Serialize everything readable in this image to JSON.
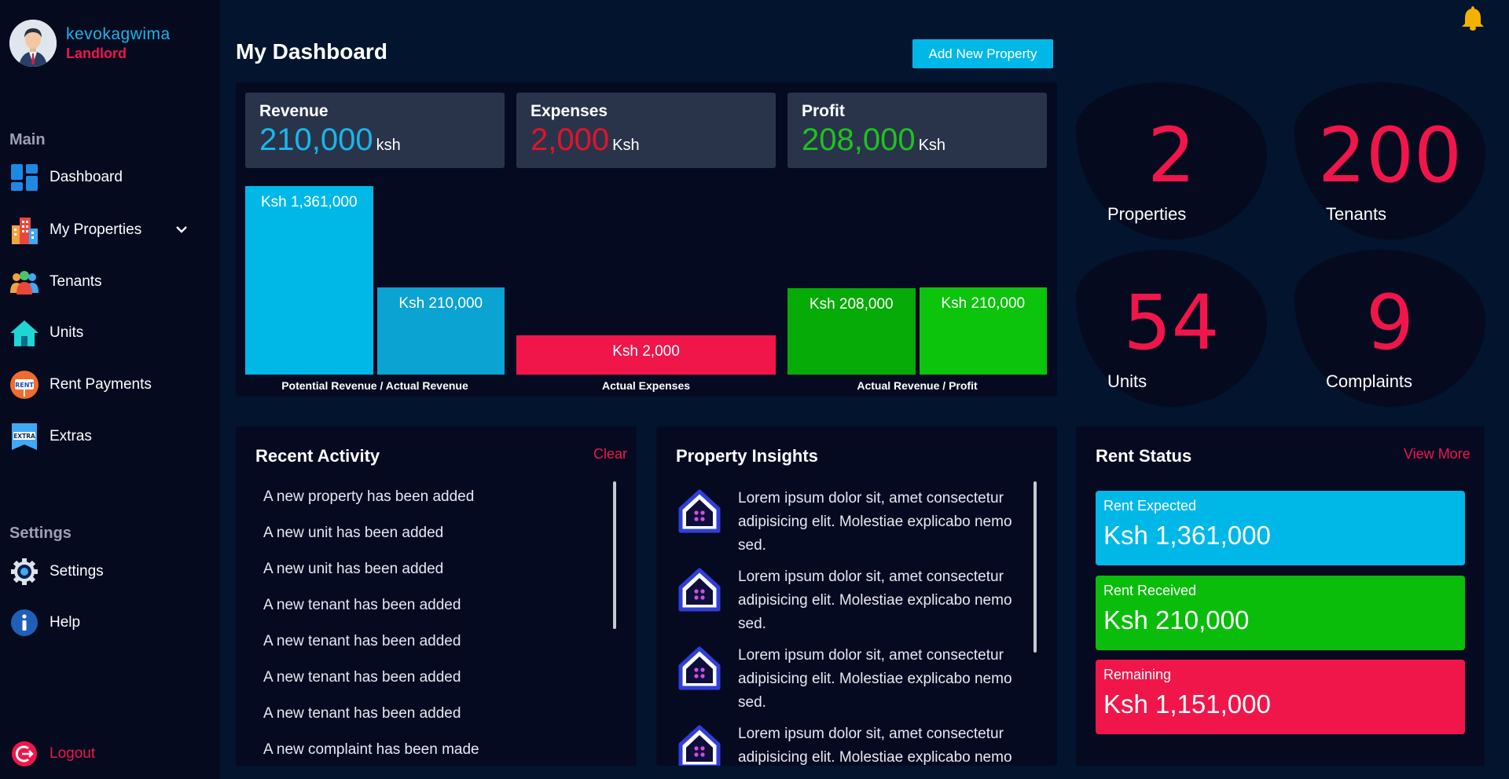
{
  "user": {
    "name": "kevokagwima",
    "role": "Landlord"
  },
  "sidebar": {
    "main_label": "Main",
    "settings_label": "Settings",
    "items": [
      {
        "label": "Dashboard",
        "icon": "dashboard-icon"
      },
      {
        "label": "My Properties",
        "icon": "buildings-icon"
      },
      {
        "label": "Tenants",
        "icon": "people-icon"
      },
      {
        "label": "Units",
        "icon": "house-icon"
      },
      {
        "label": "Rent Payments",
        "icon": "rent-sign-icon"
      },
      {
        "label": "Extras",
        "icon": "extra-flag-icon"
      }
    ],
    "settings_items": [
      {
        "label": "Settings",
        "icon": "gear-icon"
      },
      {
        "label": "Help",
        "icon": "info-icon"
      }
    ],
    "logout_label": "Logout"
  },
  "header": {
    "title": "My Dashboard",
    "add_button": "Add New Property"
  },
  "summary": {
    "revenue": {
      "title": "Revenue",
      "value": "210,000",
      "unit": "ksh",
      "color": "#19b6ea"
    },
    "expenses": {
      "title": "Expenses",
      "value": "2,000",
      "unit": "Ksh",
      "color": "#e0142a"
    },
    "profit": {
      "title": "Profit",
      "value": "208,000",
      "unit": "Ksh",
      "color": "#1ec21e"
    }
  },
  "chart_data": {
    "type": "bar",
    "groups": [
      {
        "label": "Potential Revenue / Actual Revenue",
        "bars": [
          {
            "label": "Ksh 1,361,000",
            "value": 1361000,
            "color": "#00b8e8"
          },
          {
            "label": "Ksh 210,000",
            "value": 210000,
            "color": "#0aa3d2"
          }
        ]
      },
      {
        "label": "Actual Expenses",
        "bars": [
          {
            "label": "Ksh 2,000",
            "value": 2000,
            "color": "#f0164a"
          }
        ]
      },
      {
        "label": "Actual Revenue / Profit",
        "bars": [
          {
            "label": "Ksh 208,000",
            "value": 208000,
            "color": "#07ab07"
          },
          {
            "label": "Ksh 210,000",
            "value": 210000,
            "color": "#0bc40b"
          }
        ]
      }
    ]
  },
  "counters": [
    {
      "number": "2",
      "label": "Properties"
    },
    {
      "number": "200",
      "label": "Tenants"
    },
    {
      "number": "54",
      "label": "Units"
    },
    {
      "number": "9",
      "label": "Complaints"
    }
  ],
  "recent_activity": {
    "title": "Recent Activity",
    "clear_label": "Clear",
    "items": [
      "A new property has been added",
      "A new unit has been added",
      "A new unit has been added",
      "A new tenant has been added",
      "A new tenant has been added",
      "A new tenant has been added",
      "A new tenant has been added",
      "A new complaint has been made"
    ]
  },
  "insights": {
    "title": "Property Insights",
    "items": [
      "Lorem ipsum dolor sit, amet consectetur adipisicing elit. Molestiae explicabo nemo sed.",
      "Lorem ipsum dolor sit, amet consectetur adipisicing elit. Molestiae explicabo nemo sed.",
      "Lorem ipsum dolor sit, amet consectetur adipisicing elit. Molestiae explicabo nemo sed.",
      "Lorem ipsum dolor sit, amet consectetur adipisicing elit. Molestiae explicabo nemo sed."
    ]
  },
  "rent_status": {
    "title": "Rent Status",
    "view_more": "View More",
    "cards": [
      {
        "label": "Rent Expected",
        "value": "Ksh 1,361,000",
        "color": "#00b8e8"
      },
      {
        "label": "Rent Received",
        "value": "Ksh 210,000",
        "color": "#0bbd0b"
      },
      {
        "label": "Remaining",
        "value": "Ksh 1,151,000",
        "color": "#f0164a"
      }
    ]
  },
  "colors": {
    "accent_red": "#f0164a",
    "accent_blue": "#19b6ea",
    "panel": "#060a21",
    "background": "#02142e"
  }
}
